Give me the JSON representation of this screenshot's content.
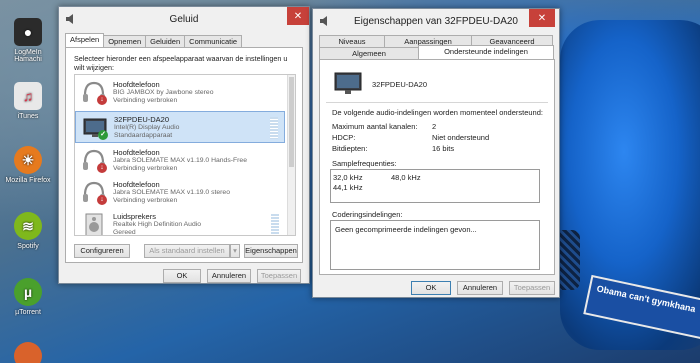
{
  "desktop": {
    "icons": [
      {
        "label": "LogMeIn Hamachi",
        "icon": "hamachi-icon"
      },
      {
        "label": "iTunes",
        "icon": "itunes-icon"
      },
      {
        "label": "Mozilla Firefox",
        "icon": "firefox-icon"
      },
      {
        "label": "Spotify",
        "icon": "spotify-icon"
      },
      {
        "label": "µTorrent",
        "icon": "utorrent-icon"
      }
    ],
    "wallpaper_plate": "Obama can't gymkhana"
  },
  "sound": {
    "title": "Geluid",
    "tabs": [
      "Afspelen",
      "Opnemen",
      "Geluiden",
      "Communicatie"
    ],
    "instruction": "Selecteer hieronder een afspeelapparaat waarvan de instellingen u wilt wijzigen:",
    "devices": [
      {
        "name": "Hoofdtelefoon",
        "desc": "BIG JAMBOX by Jawbone stereo",
        "status": "Verbinding verbroken"
      },
      {
        "name": "32FPDEU-DA20",
        "desc": "Intel(R) Display Audio",
        "status": "Standaardapparaat"
      },
      {
        "name": "Hoofdtelefoon",
        "desc": "Jabra SOLEMATE MAX v1.19.0 Hands-Free",
        "status": "Verbinding verbroken"
      },
      {
        "name": "Hoofdtelefoon",
        "desc": "Jabra SOLEMATE MAX v1.19.0 stereo",
        "status": "Verbinding verbroken"
      },
      {
        "name": "Luidsprekers",
        "desc": "Realtek High Definition Audio",
        "status": "Gereed"
      }
    ],
    "buttons": {
      "configure": "Configureren",
      "set_default": "Als standaard instellen",
      "properties": "Eigenschappen"
    },
    "footer": {
      "ok": "OK",
      "cancel": "Annuleren",
      "apply": "Toepassen"
    }
  },
  "props": {
    "title": "Eigenschappen van  32FPDEU-DA20",
    "tabs_row1": [
      "Niveaus",
      "Aanpassingen",
      "Geavanceerd"
    ],
    "tabs_row2": [
      "Algemeen",
      "Ondersteunde indelingen"
    ],
    "device_name": "32FPDEU-DA20",
    "intro": "De volgende audio-indelingen worden momenteel ondersteund:",
    "rows": [
      {
        "key": "Maximum aantal kanalen:",
        "value": "2"
      },
      {
        "key": "HDCP:",
        "value": "Niet ondersteund"
      },
      {
        "key": "Bitdiepten:",
        "value": "16 bits"
      }
    ],
    "sample_label": "Samplefrequenties:",
    "samples": [
      "32,0 kHz",
      "48,0 kHz",
      "44,1 kHz"
    ],
    "encoded_label": "Coderingsindelingen:",
    "encoded_value": "Geen gecomprimeerde indelingen gevon...",
    "footer": {
      "ok": "OK",
      "cancel": "Annuleren",
      "apply": "Toepassen"
    }
  }
}
